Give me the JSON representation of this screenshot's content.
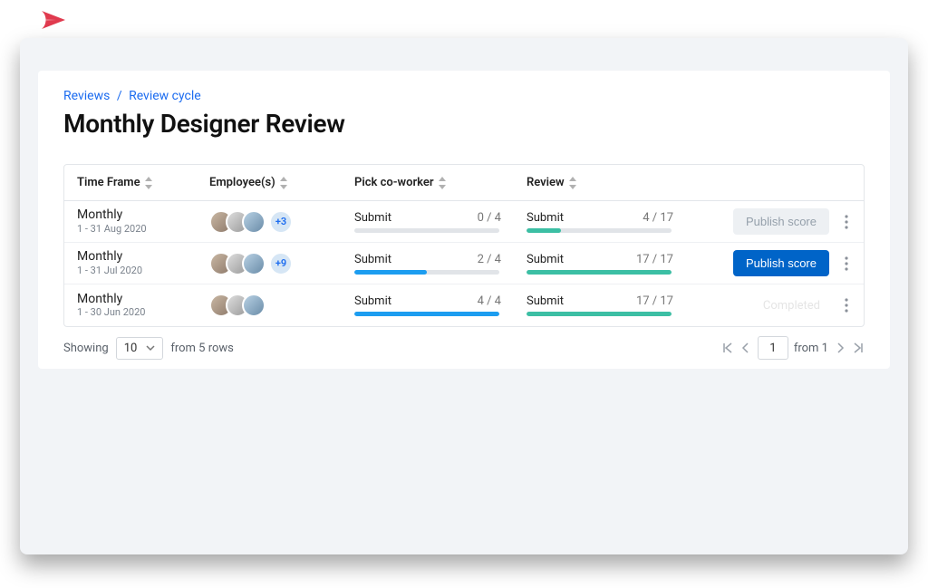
{
  "breadcrumb": {
    "root": "Reviews",
    "current": "Review cycle"
  },
  "title": "Monthly Designer Review",
  "columns": {
    "time": "Time Frame",
    "employee": "Employee(s)",
    "pick": "Pick co-worker",
    "review": "Review"
  },
  "rows": [
    {
      "period": "Monthly",
      "range": "1 - 31 Aug 2020",
      "more": "+3",
      "pick": {
        "label": "Submit",
        "count": "0 / 4",
        "pct": 0,
        "color": "blue"
      },
      "review": {
        "label": "Submit",
        "count": "4 / 17",
        "pct": 24,
        "color": "teal"
      },
      "action": {
        "type": "disabled",
        "label": "Publish score"
      }
    },
    {
      "period": "Monthly",
      "range": "1 - 31 Jul 2020",
      "more": "+9",
      "pick": {
        "label": "Submit",
        "count": "2 / 4",
        "pct": 50,
        "color": "blue"
      },
      "review": {
        "label": "Submit",
        "count": "17 / 17",
        "pct": 100,
        "color": "teal"
      },
      "action": {
        "type": "primary",
        "label": "Publish score"
      }
    },
    {
      "period": "Monthly",
      "range": "1 - 30 Jun 2020",
      "more": "",
      "pick": {
        "label": "Submit",
        "count": "4 / 4",
        "pct": 100,
        "color": "blue"
      },
      "review": {
        "label": "Submit",
        "count": "17 / 17",
        "pct": 100,
        "color": "teal"
      },
      "action": {
        "type": "completed",
        "label": "Completed"
      }
    }
  ],
  "footer": {
    "showing": "Showing",
    "perPage": "10",
    "fromRows": "from 5 rows",
    "page": "1",
    "fromPages": "from 1"
  }
}
